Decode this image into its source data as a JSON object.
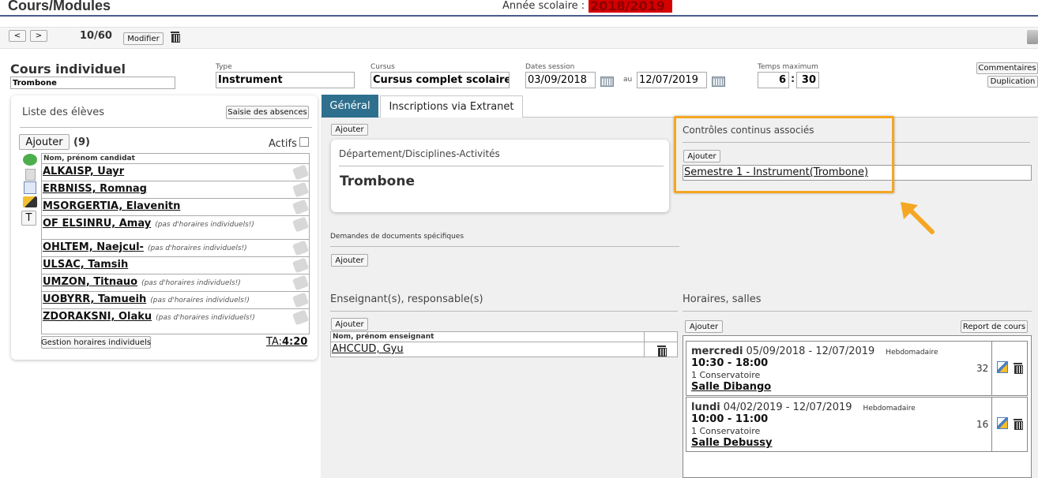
{
  "header": {
    "title": "Cours/Modules",
    "year_label": "Année scolaire :",
    "year_value": "2018/2019",
    "counter": "10/60",
    "prev": "<",
    "next": ">",
    "modify": "Modifier"
  },
  "course": {
    "type_title": "Cours individuel",
    "name": "Trombone",
    "type_label": "Type",
    "type_value": "Instrument",
    "cursus_label": "Cursus",
    "cursus_value": "Cursus complet scolaire",
    "dates_label": "Dates session",
    "date_from": "03/09/2018",
    "au": "au",
    "date_to": "12/07/2019",
    "time_label": "Temps maximum",
    "time_h": "6",
    "time_m": "30",
    "comments_btn": "Commentaires",
    "dup_btn": "Duplication"
  },
  "students": {
    "title": "Liste des élèves",
    "absence_btn": "Saisie des absences",
    "add_btn": "Ajouter",
    "count": "(9)",
    "active_label": "Actifs",
    "col_header": "Nom, prénom candidat",
    "side_letter": "T",
    "rows": [
      {
        "name": "ALKAISP, Uayr",
        "note": ""
      },
      {
        "name": "ERBNISS, Romnag",
        "note": ""
      },
      {
        "name": "MSORGERTIA, Elavenitn",
        "note": ""
      },
      {
        "name": "OF ELSINRU, Amay",
        "note": "(pas d'horaires individuels!)"
      },
      {
        "name": "OHLTEM, Naejcul-",
        "note": "(pas d'horaires individuels!)"
      },
      {
        "name": "ULSAC, Tamsih",
        "note": ""
      },
      {
        "name": "UMZON, Titnauo",
        "note": "(pas d'horaires individuels!)"
      },
      {
        "name": "UOBYRR, Tamueih",
        "note": "(pas d'horaires individuels!)"
      },
      {
        "name": "ZDORAKSNI, Olaku",
        "note": "(pas d'horaires individuels!)"
      }
    ],
    "gestion_btn": "Gestion horaires individuels",
    "ta_label": "TA:",
    "ta_value": "4:20"
  },
  "tabs": [
    "Général",
    "Inscriptions via Extranet"
  ],
  "general": {
    "add": "Ajouter",
    "dept_title": "Département/Disciplines-Activités",
    "dept_value": "Trombone",
    "docs_title": "Demandes de documents spécifiques",
    "controls_title": "Contrôles continus associés",
    "control_item": "Semestre 1 - Instrument(Trombone)",
    "teachers_title": "Enseignant(s), responsable(s)",
    "teachers_col": "Nom, prénom enseignant",
    "teacher": "AHCCUD, Gyu",
    "schedule_title": "Horaires, salles",
    "report_btn": "Report de cours",
    "schedules": [
      {
        "day": "mercredi",
        "range": "05/09/2018 - 12/07/2019",
        "freq": "Hebdomadaire",
        "time": "10:30 - 18:00",
        "place": "1 Conservatoire",
        "room": "Salle Dibango",
        "count": "32"
      },
      {
        "day": "lundi",
        "range": "04/02/2019 - 12/07/2019",
        "freq": "Hebdomadaire",
        "time": "10:00 - 11:00",
        "place": "1 Conservatoire",
        "room": "Salle Debussy",
        "count": "16"
      }
    ]
  },
  "colors": {
    "accent": "#2e6f8e",
    "highlight": "#f5a623",
    "year_bg": "#d40000"
  }
}
